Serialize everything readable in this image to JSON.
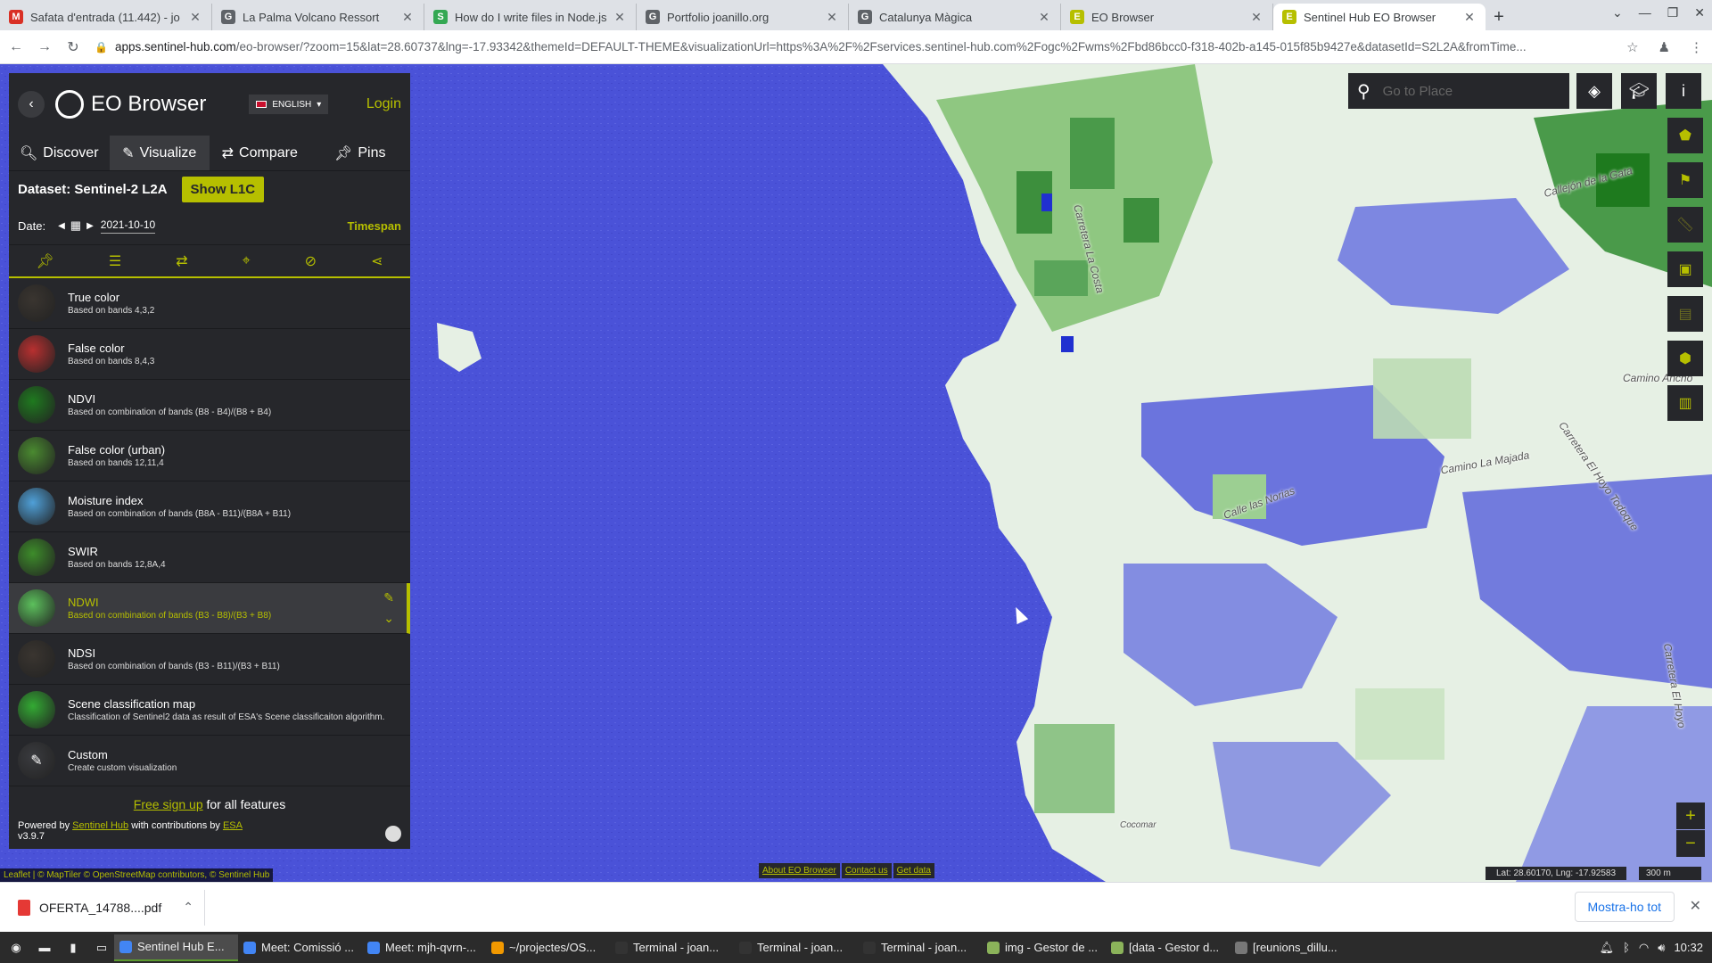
{
  "browser": {
    "tabs": [
      {
        "title": "Safata d'entrada (11.442) - jo",
        "color": "#d93025",
        "icon": "M"
      },
      {
        "title": "La Palma Volcano Ressort",
        "color": "#5f6368",
        "icon": "G"
      },
      {
        "title": "How do I write files in Node.js",
        "color": "#34a853",
        "icon": "S"
      },
      {
        "title": "Portfolio joanillo.org",
        "color": "#5f6368",
        "icon": "G"
      },
      {
        "title": "Catalunya Màgica",
        "color": "#5f6368",
        "icon": "G"
      },
      {
        "title": "EO Browser",
        "color": "#b6bf00",
        "icon": "E"
      },
      {
        "title": "Sentinel Hub EO Browser",
        "color": "#b6bf00",
        "icon": "E"
      }
    ],
    "url_host": "apps.sentinel-hub.com",
    "url_path": "/eo-browser/?zoom=15&lat=28.60737&lng=-17.93342&themeId=DEFAULT-THEME&visualizationUrl=https%3A%2F%2Fservices.sentinel-hub.com%2Fogc%2Fwms%2Fbd86bcc0-f318-402b-a145-015f85b9427e&datasetId=S2L2A&fromTime..."
  },
  "panel": {
    "app_title": "EO Browser",
    "language": "ENGLISH",
    "login": "Login",
    "tabs": [
      {
        "label": "Discover",
        "icon": "search-icon"
      },
      {
        "label": "Visualize",
        "icon": "brush-icon"
      },
      {
        "label": "Compare",
        "icon": "compare-icon"
      },
      {
        "label": "Pins",
        "icon": "pin-icon"
      }
    ],
    "dataset_label": "Dataset: Sentinel-2 L2A",
    "show_l1c": "Show L1C",
    "date_label": "Date:",
    "date_value": "2021-10-10",
    "timespan": "Timespan",
    "layers": [
      {
        "name": "True color",
        "desc": "Based on bands 4,3,2",
        "color": "#3a3530"
      },
      {
        "name": "False color",
        "desc": "Based on bands 8,4,3",
        "color": "#b83030"
      },
      {
        "name": "NDVI",
        "desc": "Based on combination of bands (B8 - B4)/(B8 + B4)",
        "color": "#1f7a1f"
      },
      {
        "name": "False color (urban)",
        "desc": "Based on bands 12,11,4",
        "color": "#4a8a30"
      },
      {
        "name": "Moisture index",
        "desc": "Based on combination of bands (B8A - B11)/(B8A + B11)",
        "color": "#4fa0d8"
      },
      {
        "name": "SWIR",
        "desc": "Based on bands 12,8A,4",
        "color": "#3d8c2a"
      },
      {
        "name": "NDWI",
        "desc": "Based on combination of bands (B3 - B8)/(B3 + B8)",
        "color": "#5cc05c"
      },
      {
        "name": "NDSI",
        "desc": "Based on combination of bands (B3 - B11)/(B3 + B11)",
        "color": "#3a3530"
      },
      {
        "name": "Scene classification map",
        "desc": "Classification of Sentinel2 data as result of ESA's Scene classificaiton algorithm.",
        "color": "#33aa33"
      },
      {
        "name": "Custom",
        "desc": "Create custom visualization",
        "color": "#3a3b3f"
      }
    ],
    "signup_link": "Free sign up",
    "signup_rest": " for all features",
    "powered_by": "Powered by ",
    "sentinel_hub": "Sentinel Hub",
    "contrib": " with contributions by ",
    "esa": "ESA",
    "version": "v3.9.7"
  },
  "map": {
    "search_placeholder": "Go to Place",
    "attribution": "Leaflet | © MapTiler © OpenStreetMap contributors, © Sentinel Hub",
    "links": [
      "About EO Browser",
      "Contact us",
      "Get data"
    ],
    "coords": "Lat: 28.60170, Lng: -17.92583",
    "scale": "300 m",
    "labels": [
      "Carretera La Costa",
      "Callejón de la Gata",
      "Camino Ancho",
      "Carretera El Hoyo Todoque",
      "Camino La Majada",
      "Calle las Norias",
      "Carretera El Hoyo",
      "Cocomar"
    ]
  },
  "downloads": {
    "file": "OFERTA_14788....pdf",
    "show_all": "Mostra-ho tot"
  },
  "taskbar": {
    "tasks": [
      {
        "label": "Sentinel Hub E...",
        "color": "#4285f4"
      },
      {
        "label": "Meet: Comissió ...",
        "color": "#4285f4"
      },
      {
        "label": "Meet: mjh-qvrn-...",
        "color": "#4285f4"
      },
      {
        "label": "~/projectes/OS...",
        "color": "#f29900"
      },
      {
        "label": "Terminal - joan...",
        "color": "#333"
      },
      {
        "label": "Terminal - joan...",
        "color": "#333"
      },
      {
        "label": "Terminal - joan...",
        "color": "#333"
      },
      {
        "label": "img - Gestor de ...",
        "color": "#8bb35a"
      },
      {
        "label": "[data - Gestor d...",
        "color": "#8bb35a"
      },
      {
        "label": "[reunions_dillu...",
        "color": "#777"
      }
    ],
    "time": "10:32"
  }
}
